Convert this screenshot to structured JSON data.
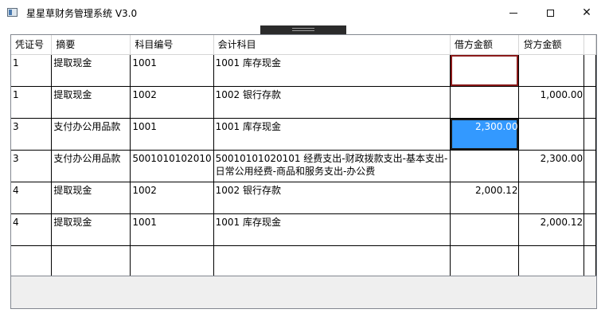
{
  "window": {
    "title": "星星草财务管理系统 V3.0",
    "controls": {
      "minimize": "minimize-icon",
      "maximize": "maximize-icon",
      "close": "close-icon"
    }
  },
  "grid": {
    "columns": [
      "凭证号",
      "摘要",
      "科目编号",
      "会计科目",
      "借方金额",
      "贷方金额",
      ""
    ],
    "rows": [
      {
        "voucher": "1",
        "summary": "提取现金",
        "code": "1001",
        "account": "1001 库存现金",
        "debit": "",
        "credit": ""
      },
      {
        "voucher": "1",
        "summary": "提取现金",
        "code": "1002",
        "account": "1002 银行存款",
        "debit": "",
        "credit": "1,000.00"
      },
      {
        "voucher": "3",
        "summary": "支付办公用品款",
        "code": "1001",
        "account": "1001 库存现金",
        "debit": "2,300.00",
        "credit": ""
      },
      {
        "voucher": "3",
        "summary": "支付办公用品款",
        "code": "5001010102010",
        "account": "50010101020101 经费支出-财政拨款支出-基本支出-日常公用经费-商品和服务支出-办公费",
        "debit": "",
        "credit": "2,300.00"
      },
      {
        "voucher": "4",
        "summary": "提取现金",
        "code": "1002",
        "account": "1002 银行存款",
        "debit": "2,000.12",
        "credit": ""
      },
      {
        "voucher": "4",
        "summary": "提取现金",
        "code": "1001",
        "account": "1001 库存现金",
        "debit": "",
        "credit": "2,000.12"
      },
      {
        "voucher": "",
        "summary": "",
        "code": "",
        "account": "",
        "debit": "",
        "credit": ""
      }
    ]
  },
  "colors": {
    "selected_cell": "#3399ff",
    "focused_border": "#8b1a1a"
  }
}
